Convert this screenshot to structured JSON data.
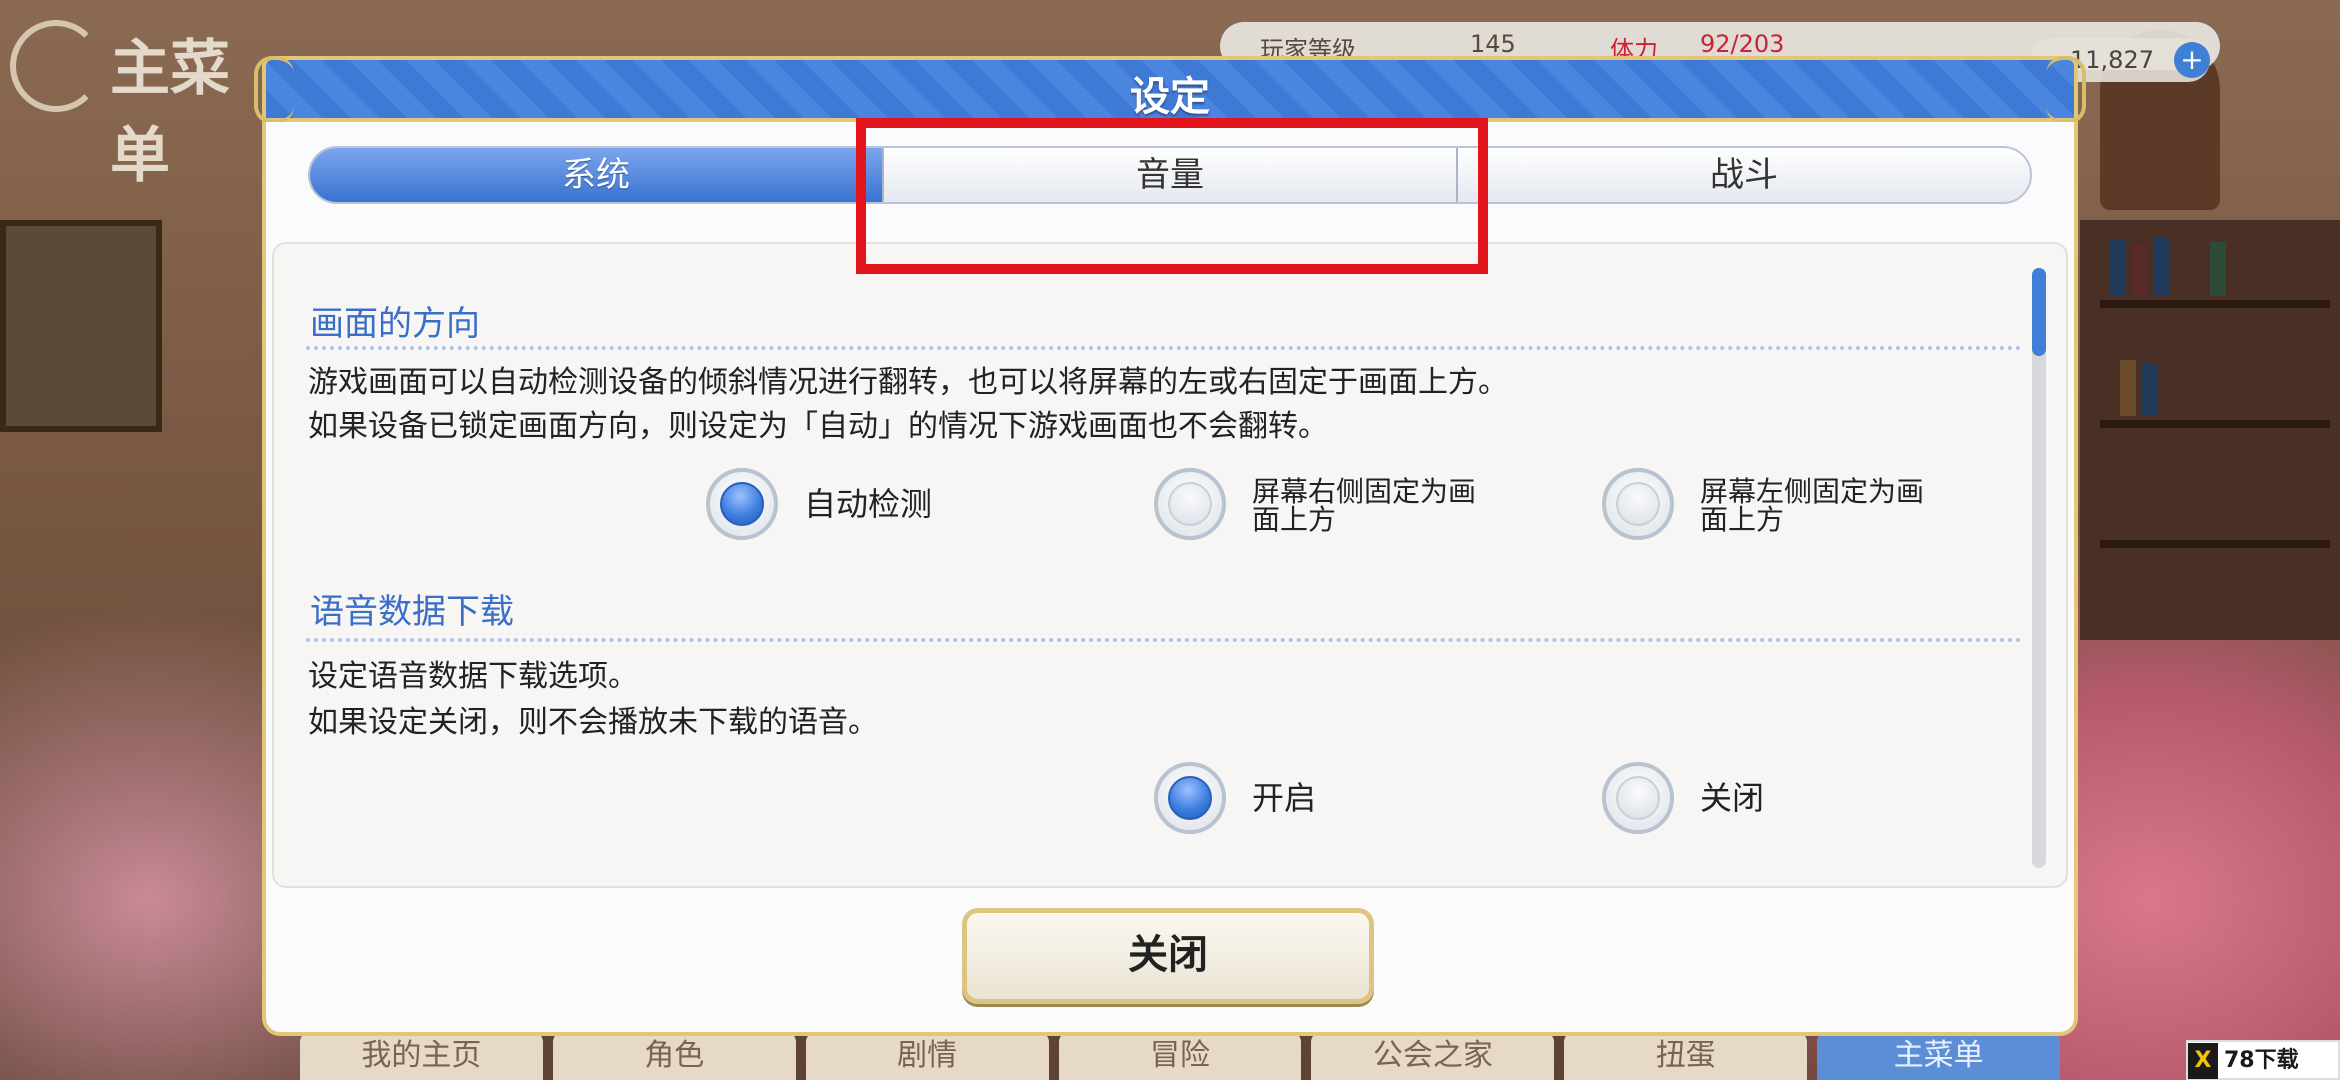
{
  "background": {
    "logo_text": "主菜单",
    "topbar_level_label": "玩家等级",
    "topbar_level": "145",
    "topbar_stamina_label": "体力",
    "topbar_stamina": "92/203",
    "coins": "11,827",
    "coins_plus": "+",
    "nav": [
      "我的主页",
      "角色",
      "剧情",
      "冒险",
      "公会之家",
      "扭蛋",
      "主菜单"
    ]
  },
  "dialog": {
    "title": "设定",
    "tabs": [
      {
        "label": "系统",
        "active": true
      },
      {
        "label": "音量",
        "active": false
      },
      {
        "label": "战斗",
        "active": false
      }
    ],
    "sections": [
      {
        "title": "画面的方向",
        "desc": [
          "游戏画面可以自动检测设备的倾斜情况进行翻转，也可以将屏幕的左或右固定于画面上方。",
          "如果设备已锁定画面方向，则设定为「自动」的情况下游戏画面也不会翻转。"
        ],
        "options": [
          {
            "label": "自动检测",
            "selected": true
          },
          {
            "label": "屏幕右侧固定为画面上方",
            "selected": false
          },
          {
            "label": "屏幕左侧固定为画面上方",
            "selected": false
          }
        ]
      },
      {
        "title": "语音数据下载",
        "desc": [
          "设定语音数据下载选项。",
          "如果设定关闭，则不会播放未下载的语音。"
        ],
        "options": [
          {
            "label": "开启",
            "selected": true
          },
          {
            "label": "关闭",
            "selected": false
          }
        ]
      }
    ],
    "close_label": "关闭"
  },
  "highlight_color": "#e2141c",
  "accent_color": "#3f7fd6",
  "watermark": {
    "logo_glyph": "X",
    "text": "78下载"
  }
}
